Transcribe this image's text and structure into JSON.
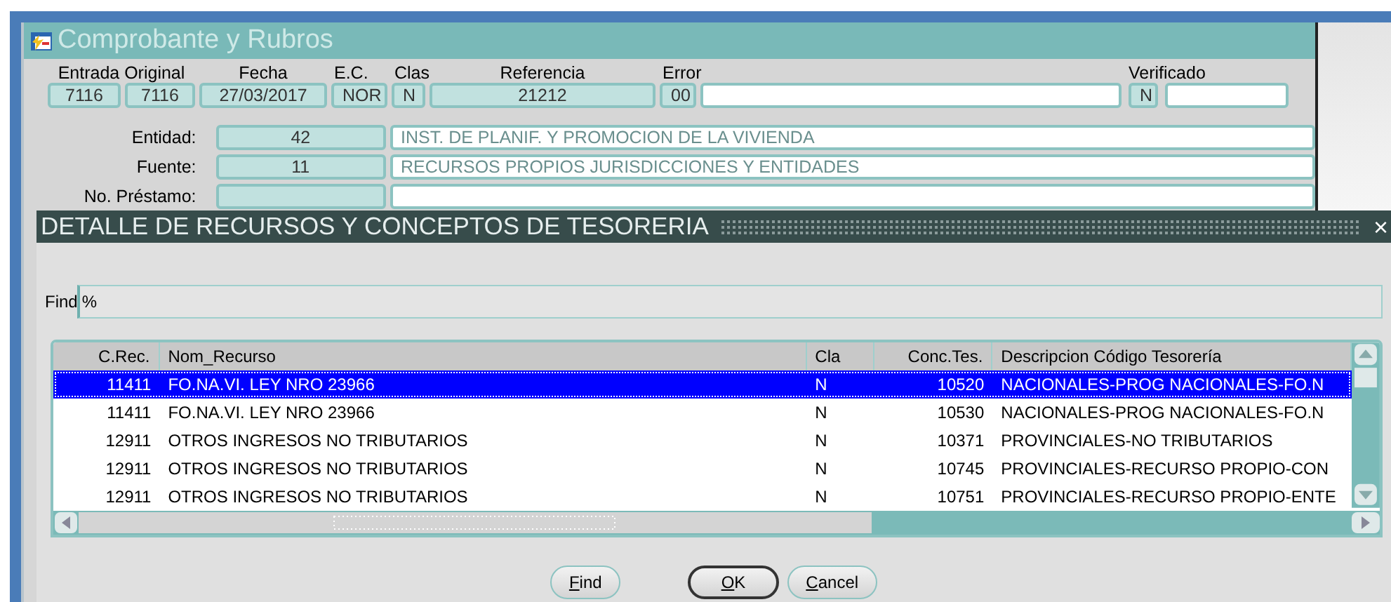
{
  "back_window": {
    "title": "Comprobante y Rubros",
    "headers": [
      "Entrada Original",
      "Fecha",
      "E.C.",
      "Clas",
      "Referencia",
      "Error",
      "Verificado"
    ],
    "fields": [
      "7116",
      "7116",
      "27/03/2017",
      "NOR",
      "N",
      "21212",
      "00",
      "N"
    ],
    "rows": [
      {
        "label": "Entidad:",
        "code": "42",
        "description": "INST. DE PLANIF. Y PROMOCION DE LA VIVIENDA"
      },
      {
        "label": "Fuente:",
        "code": "11",
        "description": "RECURSOS PROPIOS JURISDICCIONES Y ENTIDADES"
      },
      {
        "label": "No. Préstamo:"
      }
    ]
  },
  "dialog": {
    "title": "DETALLE DE RECURSOS Y CONCEPTOS DE TESORERIA",
    "close": "×",
    "find_label": "Find",
    "find_value": "%",
    "table": {
      "columns": [
        "C.Rec.",
        "Nom_Recurso",
        "Cla",
        "Conc.Tes.",
        "Descripcion Código Tesorería"
      ],
      "rows": [
        {
          "cells": [
            "11411",
            "FO.NA.VI. LEY NRO 23966",
            "N",
            "10520",
            "NACIONALES-PROG NACIONALES-FO.N"
          ],
          "selected": true
        },
        {
          "cells": [
            "11411",
            "FO.NA.VI. LEY NRO 23966",
            "N",
            "10530",
            "NACIONALES-PROG NACIONALES-FO.N"
          ],
          "selected": false
        },
        {
          "cells": [
            "12911",
            "OTROS INGRESOS NO TRIBUTARIOS",
            "N",
            "10371",
            "PROVINCIALES-NO TRIBUTARIOS"
          ],
          "selected": false
        },
        {
          "cells": [
            "12911",
            "OTROS INGRESOS NO TRIBUTARIOS",
            "N",
            "10745",
            "PROVINCIALES-RECURSO PROPIO-CON"
          ],
          "selected": false
        },
        {
          "cells": [
            "12911",
            "OTROS INGRESOS NO TRIBUTARIOS",
            "N",
            "10751",
            "PROVINCIALES-RECURSO PROPIO-ENTE"
          ],
          "selected": false
        }
      ]
    },
    "buttons": [
      {
        "label": "Find",
        "default": false
      },
      {
        "label": "OK",
        "default": true
      },
      {
        "label": "Cancel",
        "default": false
      }
    ]
  }
}
